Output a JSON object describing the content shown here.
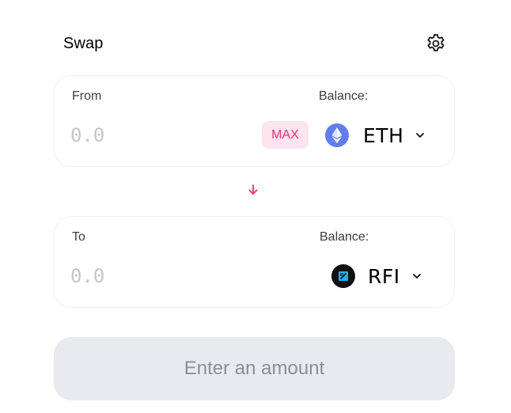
{
  "header": {
    "title": "Swap",
    "settings_icon": "gear-icon"
  },
  "from": {
    "label": "From",
    "balance_label": "Balance:",
    "amount_placeholder": "0.0",
    "max_label": "MAX",
    "token": {
      "symbol": "ETH",
      "icon": "ethereum-icon",
      "icon_color": "#627eea"
    }
  },
  "switch_icon": "arrow-down-icon",
  "to": {
    "label": "To",
    "balance_label": "Balance:",
    "amount_placeholder": "0.0",
    "token": {
      "symbol": "RFI",
      "icon": "rfi-token-icon",
      "icon_color": "#111111"
    }
  },
  "submit": {
    "label": "Enter an amount"
  },
  "colors": {
    "accent": "#e8307a",
    "accent_bg": "#fde4ee",
    "muted_text": "#c3c5cc",
    "button_bg": "#e9eaef",
    "button_text": "#8a8e99"
  }
}
